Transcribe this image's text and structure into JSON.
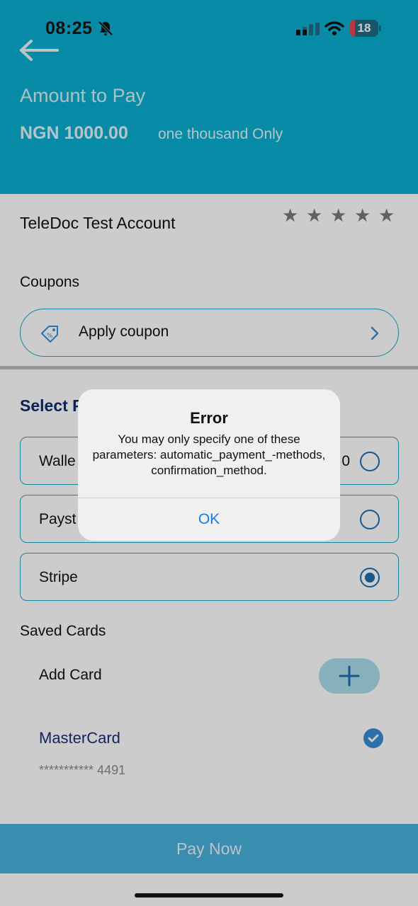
{
  "status_bar": {
    "time": "08:25",
    "battery": "18",
    "icons": [
      "bell-slash-icon",
      "signal-icon",
      "wifi-icon",
      "battery-icon"
    ]
  },
  "header": {
    "back_icon": "arrow-left-icon",
    "title": "Amount to Pay",
    "amount": "NGN 1000.00",
    "amount_words": "one thousand Only"
  },
  "account": {
    "name": "TeleDoc Test Account",
    "rating_stars": 5,
    "rating_filled": 0
  },
  "coupons": {
    "label": "Coupons",
    "button_label": "Apply coupon",
    "icon": "coupon-tag-icon"
  },
  "payment": {
    "title_visible": "Select P",
    "options": [
      {
        "label": "Walle",
        "extra": "0",
        "selected": false
      },
      {
        "label": "Payst",
        "extra": "",
        "selected": false
      },
      {
        "label": "Stripe",
        "extra": "",
        "selected": true
      }
    ]
  },
  "saved_cards": {
    "title": "Saved Cards",
    "add_label": "Add Card",
    "cards": [
      {
        "name": "MasterCard",
        "number": "*********** 4491",
        "selected": true
      }
    ]
  },
  "footer": {
    "pay_label": "Pay Now"
  },
  "alert": {
    "title": "Error",
    "message": "You may only specify one of these parameters: automatic_payment_-methods, confirmation_method.",
    "ok_label": "OK"
  },
  "colors": {
    "header": "#0aaed0",
    "accent_border": "#1aa6c7",
    "radio": "#1f6db0",
    "pay_button": "#48b2dc",
    "alert_action": "#1a7be0"
  }
}
